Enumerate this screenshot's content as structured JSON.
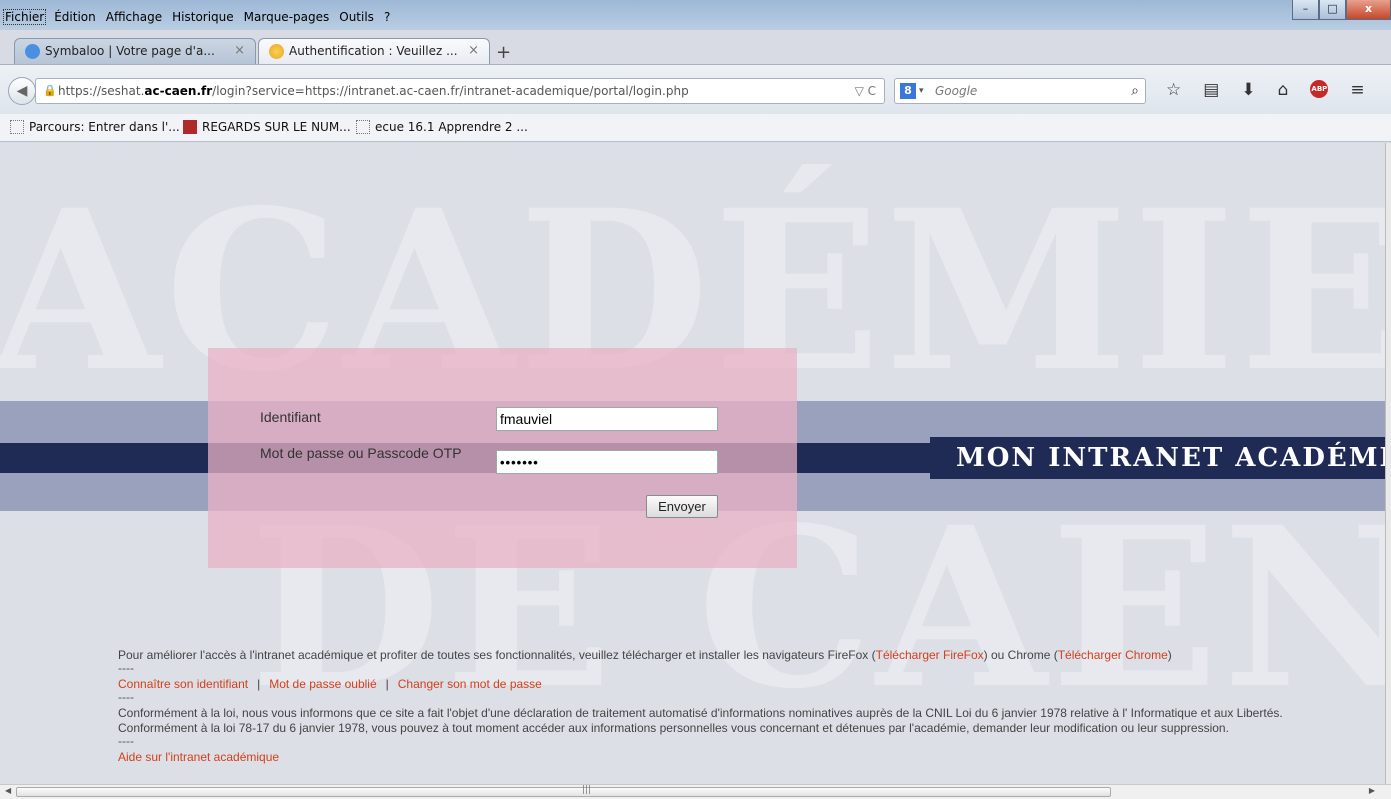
{
  "menubar": {
    "items": [
      "Fichier",
      "Édition",
      "Affichage",
      "Historique",
      "Marque-pages",
      "Outils",
      "?"
    ]
  },
  "tabs": [
    {
      "title": "Symbaloo | Votre page d'a...",
      "close": "×",
      "icon": "symbaloo-icon"
    },
    {
      "title": "Authentification : Veuillez ...",
      "close": "×",
      "icon": "sun-icon"
    }
  ],
  "new_tab": "+",
  "navbar": {
    "url_prefix": "https://seshat.",
    "url_domain": "ac-caen.fr",
    "url_suffix": "/login?service=https://intranet.ac-caen.fr/intranet-academique/portal/login.php",
    "url_icons": "▽ C",
    "search_engine": "8",
    "search_placeholder": "Google"
  },
  "bookmarks": [
    "Parcours: Entrer dans l'...",
    "REGARDS SUR LE NUM...",
    "ecue 16.1 Apprendre 2 ..."
  ],
  "page": {
    "bg_word_top": "ACADÉMIE",
    "bg_word_bottom": "DE CAEN",
    "brand": "MON INTRANET ACADÉMIQUE",
    "login": {
      "id_label": "Identifiant",
      "id_value": "fmauviel",
      "pw_label": "Mot de passe ou Passcode OTP",
      "pw_value": "•••••••",
      "submit": "Envoyer"
    },
    "footer": {
      "browsers_text_start": "Pour améliorer l'accès à l'intranet académique et profiter de toutes ses fonctionnalités, veuillez télécharger et installer les navigateurs FireFox (",
      "firefox_link": "Télécharger FireFox",
      "browsers_text_mid": ") ou Chrome  (",
      "chrome_link": "Télécharger Chrome",
      "browsers_text_end": ")",
      "dash": "----",
      "link_identifiant": "Connaître son identifiant",
      "link_oublie": "Mot de passe oublié",
      "link_changer": "Changer son mot de passe",
      "separator": "|",
      "cnil_line1": "Conformément à la loi, nous vous informons que ce site a fait l'objet d'une déclaration de traitement automatisé d'informations nominatives auprès de la CNIL Loi du 6 janvier 1978 relative à l' Informatique et aux Libertés.",
      "cnil_line2": "Conformément à la loi 78-17 du 6 janvier 1978, vous pouvez à tout moment accéder aux informations personnelles vous concernant et détenues par l'académie, demander leur modification ou leur suppression.",
      "help_link": "Aide sur l'intranet académique"
    }
  },
  "colors": {
    "brand_navy": "#1f2a55",
    "band": "#8e96b4",
    "login_box": "#e9b2c4",
    "link": "#d3401c"
  }
}
